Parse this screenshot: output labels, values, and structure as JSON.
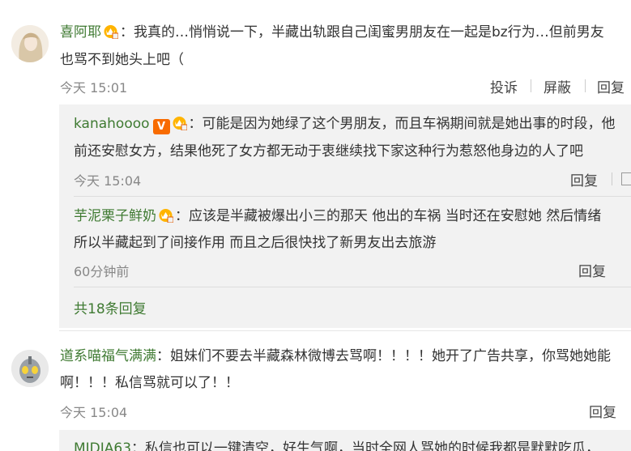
{
  "comments": [
    {
      "username": "喜阿耶",
      "text_line1": "：我真的…悄悄说一下，半藏出轨跟自己闺蜜男朋友在一起是bz行为…但前男友",
      "text_line2": "也骂不到她头上吧（",
      "time": "今天 15:01",
      "actions": [
        "投诉",
        "屏蔽",
        "回复"
      ],
      "replies": [
        {
          "username": "kanahoooo",
          "text_line1": "：可能是因为她绿了这个男朋友，而且车祸期间就是她出事的时段，他",
          "text_line2": "前还安慰女方，结果他死了女方都无动于衷继续找下家这种行为惹怒他身边的人了吧",
          "time": "今天 15:04",
          "reply_label": "回复"
        },
        {
          "username": "芋泥栗子鲜奶",
          "text_line1": "：应该是半藏被爆出小三的那天 他出的车祸 当时还在安慰她 然后情绪",
          "text_line2": "所以半藏起到了间接作用 而且之后很快找了新男友出去旅游",
          "time": "60分钟前",
          "reply_label": "回复"
        }
      ],
      "total_replies": "共18条回复"
    },
    {
      "username": "道系喵福气满满",
      "text_line1": "：姐妹们不要去半藏森林微博去骂啊！！！！她开了广告共享，你骂她她能",
      "text_line2": "啊！！！私信骂就可以了！！",
      "time": "今天 15:04",
      "reply_label": "回复",
      "partial_reply": {
        "username": "MIDIA63",
        "text": "：私信也可以一键清空，好生气啊，当时全网人骂她的时候我都是默默吃瓜，"
      }
    }
  ],
  "colors": {
    "username": "#3f7a32",
    "meta": "#888888",
    "reply_bg": "#f2f2f2"
  },
  "icons": [
    "avatar-girl-icon",
    "vip-crown-badge-icon",
    "v-verified-badge-icon",
    "avatar-ultraman-icon"
  ]
}
